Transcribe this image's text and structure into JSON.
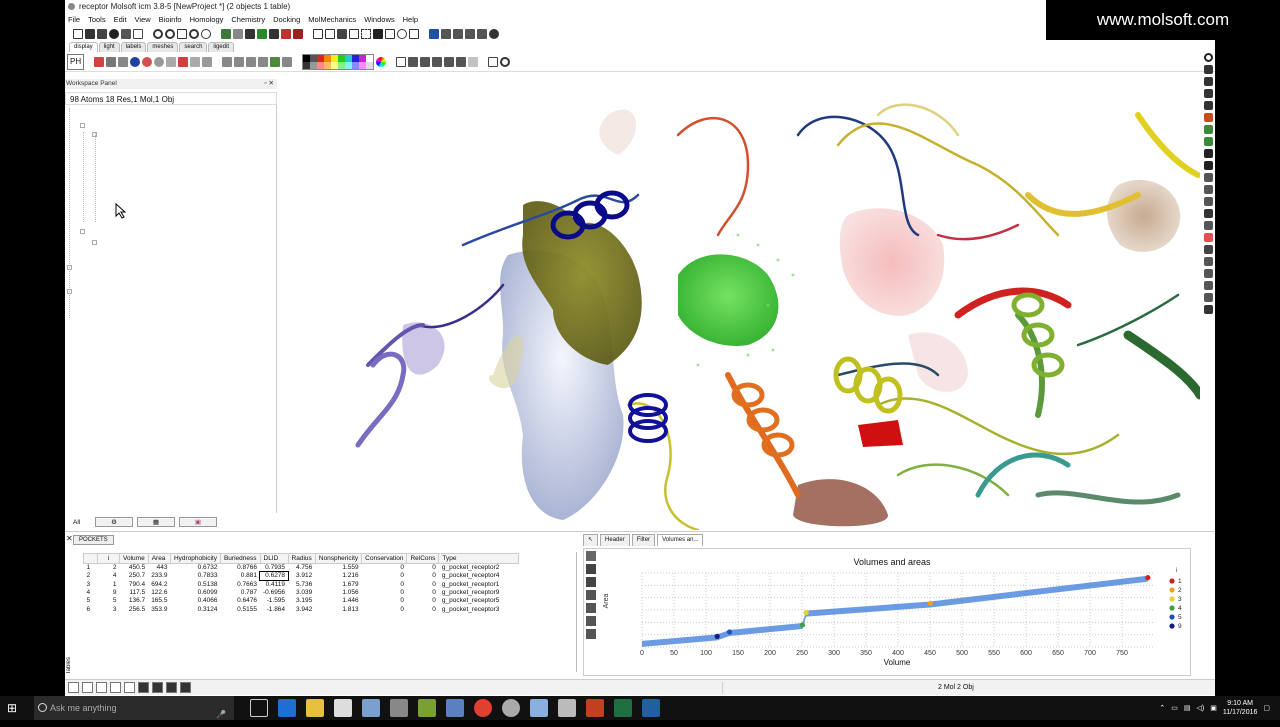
{
  "app": {
    "title": "receptor Molsoft icm 3.8-5  [NewProject *] (2 objects 1 table)",
    "menus": [
      "File",
      "Tools",
      "Edit",
      "View",
      "Bioinfo",
      "Homology",
      "Chemistry",
      "Docking",
      "MolMechanics",
      "Windows",
      "Help"
    ],
    "toolbar_tabs": [
      "display",
      "light",
      "labels",
      "meshes",
      "search",
      "ligedit"
    ],
    "ph_button": "PH"
  },
  "watermark": "www.molsoft.com",
  "workspace": {
    "panel_label": "Workspace Panel",
    "summary": "98 Atoms 18 Res,1 Mol,1 Obj",
    "bottom_tabs": [
      "All"
    ]
  },
  "pockets": {
    "tab_label": "POCKETS",
    "columns": [
      "i",
      "Volume",
      "Area",
      "Hydrophobicity",
      "Buriedness",
      "DLID",
      "Radius",
      "Nonsphericity",
      "Conservation",
      "RelCons",
      "Type"
    ],
    "rows": [
      {
        "n": "1",
        "i": "2",
        "volume": "450.5",
        "area": "443",
        "hydro": "0.6732",
        "buried": "0.8766",
        "dlid": "0.7935",
        "radius": "4.756",
        "nonsph": "1.559",
        "cons": "0",
        "relcons": "0",
        "type": "g_pocket_receptor2"
      },
      {
        "n": "2",
        "i": "4",
        "volume": "250.7",
        "area": "233.9",
        "hydro": "0.7833",
        "buried": "0.881",
        "dlid": "0.6278",
        "radius": "3.912",
        "nonsph": "1.216",
        "cons": "0",
        "relcons": "0",
        "type": "g_pocket_receptor4"
      },
      {
        "n": "3",
        "i": "1",
        "volume": "790.4",
        "area": "694.2",
        "hydro": "0.5138",
        "buried": "0.7663",
        "dlid": "0.4119",
        "radius": "5.736",
        "nonsph": "1.679",
        "cons": "0",
        "relcons": "0",
        "type": "g_pocket_receptor1"
      },
      {
        "n": "4",
        "i": "9",
        "volume": "117.5",
        "area": "122.6",
        "hydro": "0.6099",
        "buried": "0.787",
        "dlid": "-0.6956",
        "radius": "3.039",
        "nonsph": "1.056",
        "cons": "0",
        "relcons": "0",
        "type": "g_pocket_receptor9"
      },
      {
        "n": "5",
        "i": "5",
        "volume": "136.7",
        "area": "165.5",
        "hydro": "0.4066",
        "buried": "0.6476",
        "dlid": "-1.595",
        "radius": "3.195",
        "nonsph": "1.446",
        "cons": "0",
        "relcons": "0",
        "type": "g_pocket_receptor5"
      },
      {
        "n": "6",
        "i": "3",
        "volume": "256.5",
        "area": "353.9",
        "hydro": "0.3124",
        "buried": "0.5155",
        "dlid": "-1.864",
        "radius": "3.942",
        "nonsph": "1.813",
        "cons": "0",
        "relcons": "0",
        "type": "g_pocket_receptor3"
      }
    ],
    "side_tab": "Tables"
  },
  "chart_tabs": [
    "Header",
    "Filter",
    "Volumes an..."
  ],
  "chart_data": {
    "type": "scatter",
    "title": "Volumes and areas",
    "xlabel": "Volume",
    "ylabel": "Area",
    "xlim": [
      0,
      800
    ],
    "xticks": [
      "0",
      "50",
      "100",
      "150",
      "200",
      "250",
      "300",
      "350",
      "400",
      "450",
      "500",
      "550",
      "600",
      "650",
      "700",
      "750"
    ],
    "legend_title": "i",
    "legend_position": "right",
    "series": [
      {
        "name": "1",
        "color": "#d62020",
        "x": 790.4,
        "y": 694.2
      },
      {
        "name": "2",
        "color": "#f0a020",
        "x": 450.5,
        "y": 443
      },
      {
        "name": "3",
        "color": "#e8d030",
        "x": 256.5,
        "y": 353.9
      },
      {
        "name": "4",
        "color": "#3aa040",
        "x": 250.7,
        "y": 233.9
      },
      {
        "name": "5",
        "color": "#2050c0",
        "x": 136.7,
        "y": 165.5
      },
      {
        "name": "9",
        "color": "#102080",
        "x": 117.5,
        "y": 122.6
      }
    ]
  },
  "status": {
    "text": "2 Mol 2 Obj"
  },
  "taskbar": {
    "search_placeholder": "Ask me anything",
    "time": "9:10 AM",
    "date": "11/17/2016"
  }
}
